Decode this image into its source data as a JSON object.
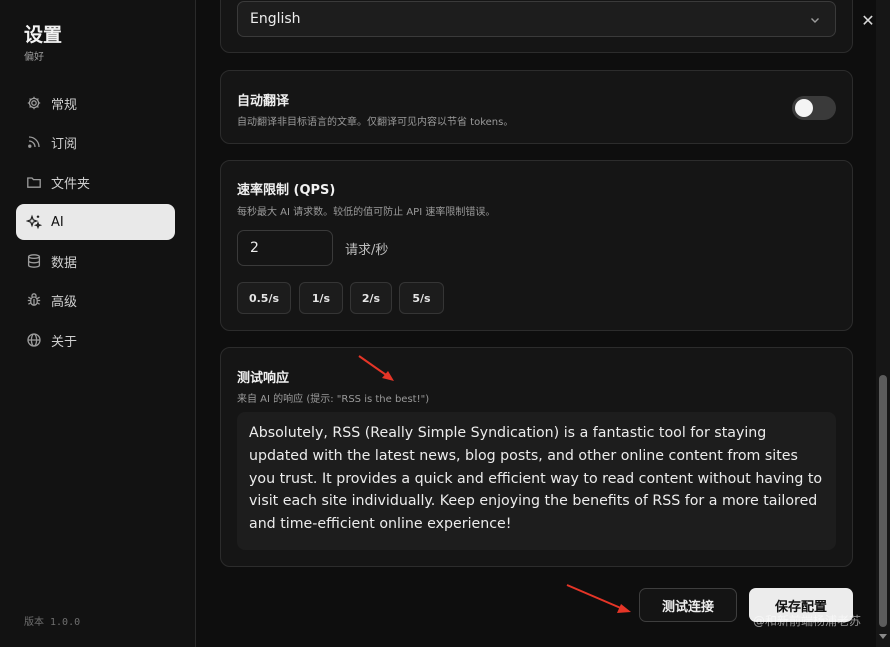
{
  "sidebar": {
    "title": "设置",
    "subtitle": "偏好",
    "items": [
      {
        "label": "常规",
        "icon": "gear-icon"
      },
      {
        "label": "订阅",
        "icon": "rss-icon"
      },
      {
        "label": "文件夹",
        "icon": "folder-icon"
      },
      {
        "label": "AI",
        "icon": "sparkles-icon",
        "active": true
      },
      {
        "label": "数据",
        "icon": "database-icon"
      },
      {
        "label": "高级",
        "icon": "bug-icon"
      },
      {
        "label": "关于",
        "icon": "globe-icon"
      }
    ],
    "version": "版本 1.0.0"
  },
  "language": {
    "selected": "English"
  },
  "auto_translate": {
    "title": "自动翻译",
    "description": "自动翻译非目标语言的文章。仅翻译可见内容以节省 tokens。",
    "enabled": false
  },
  "rate_limit": {
    "title": "速率限制 (QPS)",
    "description": "每秒最大 AI 请求数。较低的值可防止 API 速率限制错误。",
    "value": "2",
    "unit": "请求/秒",
    "presets": [
      "0.5/s",
      "1/s",
      "2/s",
      "5/s"
    ]
  },
  "test_response": {
    "title": "测试响应",
    "description": "来自 AI 的响应 (提示: \"RSS is the best!\")",
    "response": "Absolutely, RSS (Really Simple Syndication) is a fantastic tool for staying updated with the latest news, blog posts, and other online content from sites you trust. It provides a quick and efficient way to read content without having to visit each site individually. Keep enjoying the benefits of RSS for a more tailored and time-efficient online experience!"
  },
  "actions": {
    "test_label": "测试连接",
    "save_label": "保存配置"
  },
  "watermark": "@和新前端杨浦老苏",
  "colors": {
    "background": "#0e0e0e",
    "card": "#151515",
    "active_nav": "#e9e9e9",
    "annotation_arrow": "#e53527"
  }
}
